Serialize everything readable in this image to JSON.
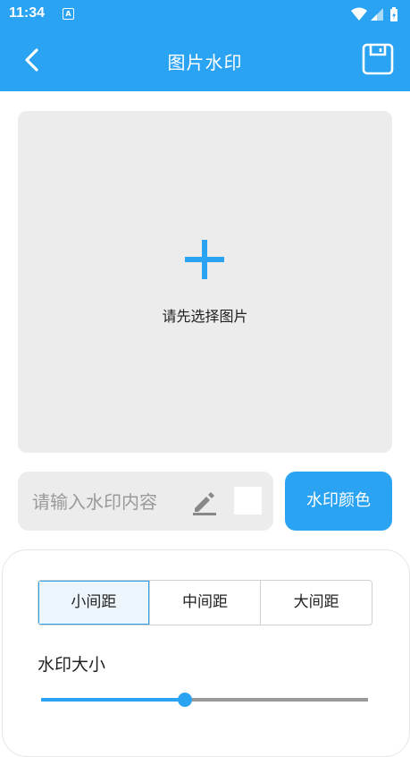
{
  "status_bar": {
    "time": "11:34",
    "notification_icon": "a-icon",
    "icons": [
      "wifi-icon",
      "signal-icon",
      "battery-icon"
    ]
  },
  "app_bar": {
    "title": "图片水印",
    "back_icon": "chevron-left-icon",
    "save_icon": "save-icon"
  },
  "image_picker": {
    "icon": "plus-icon",
    "hint": "请先选择图片"
  },
  "watermark_input": {
    "value": "",
    "placeholder": "请输入水印内容",
    "edit_icon": "pencil-icon"
  },
  "color_button": {
    "label": "水印颜色",
    "selected_color": "#ffffff"
  },
  "spacing": {
    "options": [
      "小间距",
      "中间距",
      "大间距"
    ],
    "selected": "小间距"
  },
  "size": {
    "label": "水印大小",
    "value_fraction": 0.44
  },
  "colors": {
    "accent": "#2aa3f2",
    "surface": "#ececec"
  }
}
